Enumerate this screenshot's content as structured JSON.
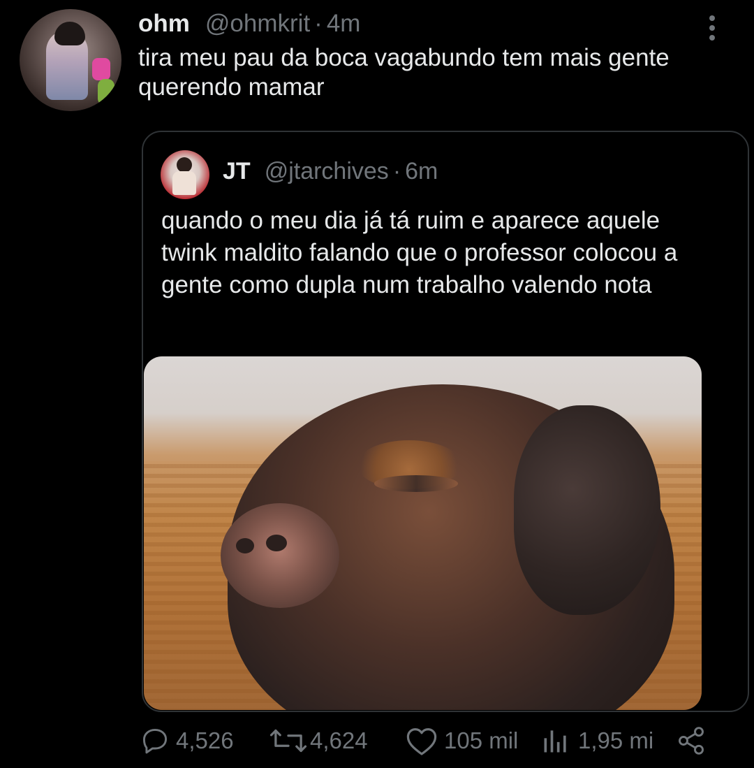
{
  "tweet": {
    "author_name": "ohm",
    "author_handle": "@ohmkrit",
    "separator": "·",
    "time": "4m",
    "text": "tira meu pau da boca vagabundo tem mais gente querendo mamar"
  },
  "quote": {
    "author_name": "JT",
    "author_handle": "@jtarchives",
    "separator": "·",
    "time": "6m",
    "text": "quando o meu dia já tá ruim e aparece aquele twink maldito falando que o professor colocou a gente como dupla num trabalho valendo nota"
  },
  "actions": {
    "replies": "4,526",
    "retweets": "4,624",
    "likes": "105 mil",
    "views": "1,95 mi"
  },
  "icons": {
    "more": "more-vertical-icon",
    "reply": "reply-icon",
    "retweet": "retweet-icon",
    "like": "heart-icon",
    "views": "views-icon",
    "share": "share-icon"
  },
  "colors": {
    "background": "#000000",
    "text": "#e7e9ea",
    "muted": "#71767b",
    "border": "#2f3336"
  }
}
